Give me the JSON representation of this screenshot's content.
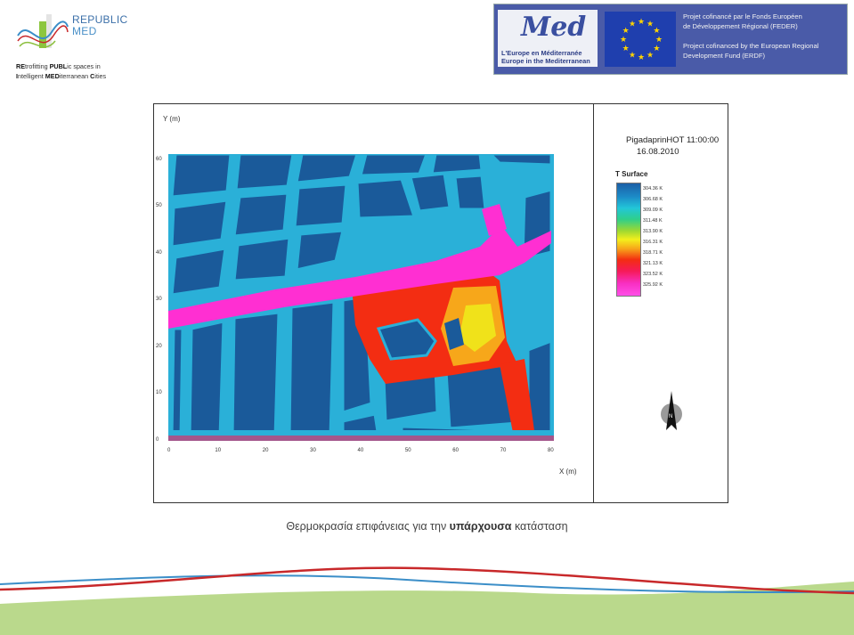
{
  "logo": {
    "name_line1": "REPUBLIC",
    "name_line2": "MED",
    "tag_line1_bold": "RE",
    "tag_line1_rest": "trofitting ",
    "tag_line1_bold2": "PUBL",
    "tag_line1_rest2": "ic spaces in",
    "tag_line2_pre": "I",
    "tag_line2_rest": "ntelligent ",
    "tag_line2_bold": "MED",
    "tag_line2_rest2": "iterranean ",
    "tag_line2_bold2": "C",
    "tag_line2_rest3": "ities"
  },
  "banner": {
    "med_word": "Med",
    "med_sub1": "L'Europe en Méditerranée",
    "med_sub2": "Europe in the Mediterranean",
    "text_l1": "Projet cofinancé par le Fonds Européen",
    "text_l2": "de Développement Régional (FEDER)",
    "text_l3": "Project cofinanced by the European Regional",
    "text_l4": "Development Fund (ERDF)"
  },
  "figure": {
    "y_axis_label": "Y (m)",
    "x_axis_label": "X (m)",
    "sim_title_l1": "PigadaprinHOT 11:00:00",
    "sim_title_l2": "16.08.2010",
    "legend_title": "T Surface",
    "legend_labels": [
      "304.36 K",
      "306.68 K",
      "309.09 K",
      "311.48 K",
      "313.90 K",
      "316.31 K",
      "318.71 K",
      "321.13 K",
      "323.52 K",
      "325.92 K"
    ],
    "x_ticks": [
      "0",
      "10",
      "20",
      "30",
      "40",
      "50",
      "60",
      "70",
      "80"
    ],
    "y_ticks": [
      "0",
      "10",
      "20",
      "30",
      "40",
      "50",
      "60"
    ],
    "colors": {
      "roof": "#1a5a9a",
      "street_cool": "#2ab0d8",
      "street_mid": "#f0e21a",
      "square_hot": "#f32d12",
      "road_hot": "#ff2fd2"
    }
  },
  "caption": {
    "part1": "Θερμοκρασία  επιφάνειας  για την ",
    "bold": "υπάρχουσα",
    "part2": " κατάσταση"
  },
  "wave_colors": {
    "red": "#c8282a",
    "blue": "#3b8ec8",
    "green": "#8cbf3f"
  }
}
